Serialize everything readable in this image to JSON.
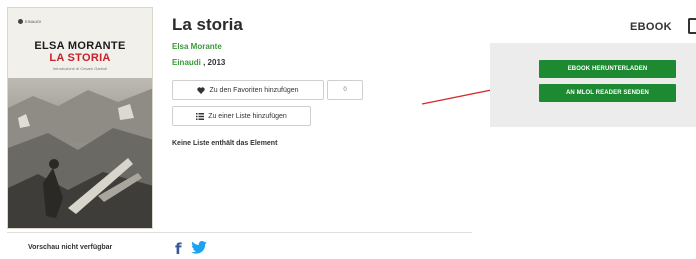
{
  "cover": {
    "publisher_mark": "EINAUDI",
    "author": "ELSA MORANTE",
    "title": "LA STORIA",
    "intro": "Introduzione di Cesare Garboli"
  },
  "book": {
    "title": "La storia",
    "author": "Elsa Morante",
    "publisher": "Einaudi",
    "year_sep": " , 2013"
  },
  "actions": {
    "favorites_label": "Zu den Favoriten hinzufügen",
    "favorites_count": "0",
    "list_label": "Zu einer Liste hinzufügen",
    "no_list_text": "Keine Liste enthält das Element"
  },
  "ebook": {
    "label": "EBOOK",
    "download_label": "EBOOK HERUNTERLADEN",
    "send_label": "AN MLOL READER SENDEN"
  },
  "footer": {
    "preview_note": "Vorschau nicht verfügbar"
  },
  "colors": {
    "accent_green": "#1d8a32",
    "link_green": "#3a9a3a",
    "arrow_red": "#d62a2a",
    "facebook": "#3b5998",
    "twitter": "#1da1f2"
  },
  "icons": [
    "heart-icon",
    "list-icon",
    "facebook-icon",
    "twitter-icon",
    "device-icon"
  ]
}
